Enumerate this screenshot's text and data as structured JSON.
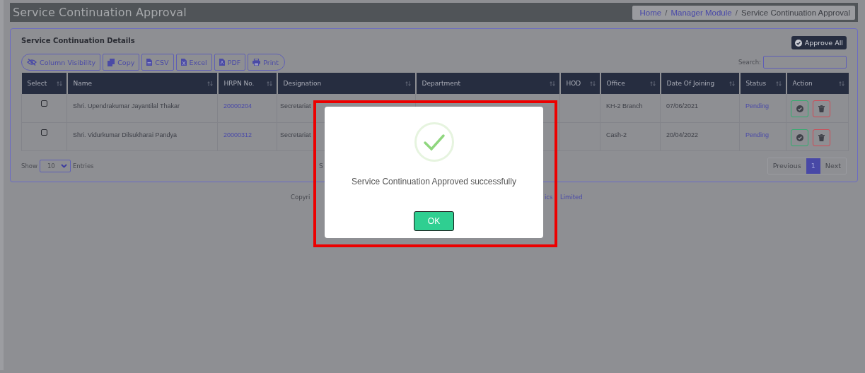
{
  "header": {
    "title": "Service Continuation Approval",
    "breadcrumb": [
      {
        "label": "Home",
        "kind": "link"
      },
      {
        "label": "/",
        "kind": "separator"
      },
      {
        "label": "Manager Module",
        "kind": "link"
      },
      {
        "label": "/",
        "kind": "separator"
      },
      {
        "label": "Service Continuation Approval",
        "kind": "current"
      }
    ]
  },
  "card": {
    "title": "Service Continuation Details",
    "approve_all": "Approve All",
    "export_buttons": [
      {
        "label": "Column Visibility",
        "kind": "visibility"
      },
      {
        "label": "Copy",
        "kind": "copy"
      },
      {
        "label": "CSV",
        "kind": "csv"
      },
      {
        "label": "Excel",
        "kind": "excel"
      },
      {
        "label": "PDF",
        "kind": "pdf"
      },
      {
        "label": "Print",
        "kind": "print"
      }
    ],
    "search_label": "Search:",
    "table": {
      "columns": [
        "Select",
        "Name",
        "HRPN No.",
        "Designation",
        "Department",
        "HOD",
        "Office",
        "Date Of Joining",
        "Status",
        "Action"
      ],
      "rows": [
        {
          "checked": false,
          "name": "Shri. Upendrakumar Jayantilal Thakar",
          "hrpn": "20000204",
          "designation": "Secretariat",
          "office": "KH-2 Branch",
          "joining": "07/06/2021",
          "status": "Pending"
        },
        {
          "checked": false,
          "name": "Shri. Vidurkumar Dilsukharai Pandya",
          "hrpn": "20000312",
          "designation": "Secretariat",
          "office": "Cash-2",
          "joining": "20/04/2022",
          "status": "Pending"
        }
      ]
    },
    "show_label": "Show",
    "page_size": "10",
    "entries_label": "Entries",
    "info": "S",
    "pagination": [
      {
        "label": "Previous",
        "selected": false
      },
      {
        "label": "1",
        "selected": true
      },
      {
        "label": "Next",
        "selected": false
      }
    ]
  },
  "footer": {
    "left": "Copyri",
    "right": [
      "ics",
      "Limited"
    ]
  },
  "dialog": {
    "message": "Service Continuation Approved successfully",
    "ok": "OK",
    "highlighted": true
  }
}
